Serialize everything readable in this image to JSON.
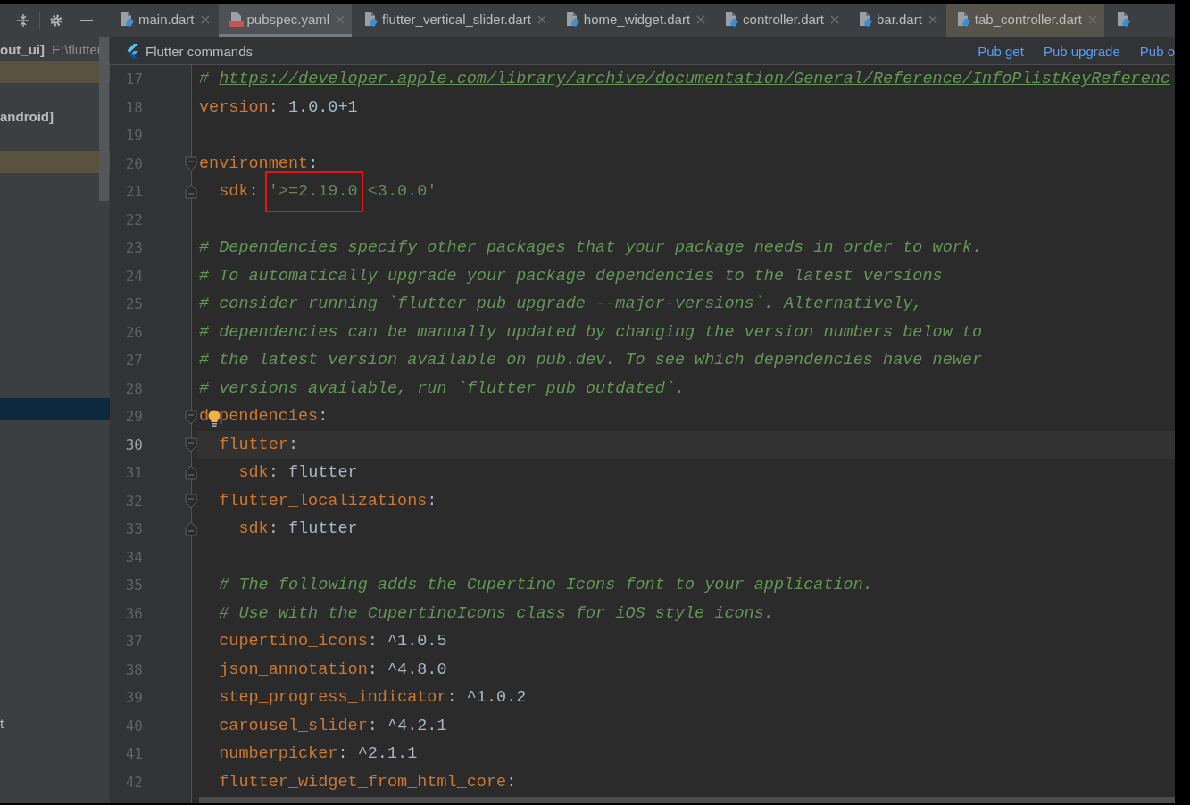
{
  "sidebar": {
    "project": "out_ui]",
    "path": "E:\\flutter",
    "items": [
      {
        "kind": "blank",
        "selected": false,
        "modified": true
      },
      {
        "kind": "blank",
        "selected": false,
        "modified": false
      },
      {
        "kind": "module",
        "label": "android]",
        "selected": false,
        "modified": false
      },
      {
        "kind": "blank",
        "selected": false,
        "modified": false
      },
      {
        "kind": "blank",
        "selected": false,
        "modified": true
      },
      {
        "kind": "blank",
        "selected": false,
        "modified": false
      },
      {
        "kind": "blank",
        "selected": false,
        "modified": false
      },
      {
        "kind": "blank",
        "selected": false,
        "modified": false
      },
      {
        "kind": "blank",
        "selected": false,
        "modified": false
      },
      {
        "kind": "blank",
        "selected": false,
        "modified": false
      },
      {
        "kind": "blank",
        "selected": false,
        "modified": false
      },
      {
        "kind": "blank",
        "selected": false,
        "modified": false
      },
      {
        "kind": "blank",
        "selected": false,
        "modified": false
      },
      {
        "kind": "blank",
        "selected": false,
        "modified": false
      },
      {
        "kind": "blank",
        "selected": false,
        "modified": false
      },
      {
        "kind": "blank",
        "selected": true,
        "modified": false
      },
      {
        "kind": "blank",
        "selected": false,
        "modified": false
      },
      {
        "kind": "blank",
        "selected": false,
        "modified": false
      },
      {
        "kind": "blank",
        "selected": false,
        "modified": false
      },
      {
        "kind": "blank",
        "selected": false,
        "modified": false
      },
      {
        "kind": "blank",
        "selected": false,
        "modified": false
      },
      {
        "kind": "blank",
        "selected": false,
        "modified": false
      },
      {
        "kind": "blank",
        "selected": false,
        "modified": false
      },
      {
        "kind": "blank",
        "selected": false,
        "modified": false
      },
      {
        "kind": "blank",
        "selected": false,
        "modified": false
      },
      {
        "kind": "blank",
        "selected": false,
        "modified": false
      },
      {
        "kind": "blank",
        "selected": false,
        "modified": false
      },
      {
        "kind": "blank",
        "selected": false,
        "modified": false
      },
      {
        "kind": "blank",
        "selected": false,
        "modified": false
      },
      {
        "kind": "file",
        "label": "t",
        "selected": false,
        "modified": false
      }
    ]
  },
  "tabs": [
    {
      "kind": "dart",
      "label": "main.dart",
      "selected": false,
      "highlighted": false
    },
    {
      "kind": "yaml",
      "label": "pubspec.yaml",
      "selected": true,
      "highlighted": false
    },
    {
      "kind": "dart",
      "label": "flutter_vertical_slider.dart",
      "selected": false,
      "highlighted": false
    },
    {
      "kind": "dart",
      "label": "home_widget.dart",
      "selected": false,
      "highlighted": false
    },
    {
      "kind": "dart",
      "label": "controller.dart",
      "selected": false,
      "highlighted": false
    },
    {
      "kind": "dart",
      "label": "bar.dart",
      "selected": false,
      "highlighted": false
    },
    {
      "kind": "dart",
      "label": "tab_controller.dart",
      "selected": false,
      "highlighted": true
    },
    {
      "kind": "dart",
      "selected": false,
      "highlighted": false
    }
  ],
  "commands_bar": {
    "title": "Flutter commands",
    "actions": [
      "Pub get",
      "Pub upgrade",
      "Pub o"
    ]
  },
  "editor": {
    "lines": [
      {
        "number": "17",
        "current": false,
        "fold_start": false,
        "fold_end": false,
        "tokens": [
          {
            "kind": "comment",
            "text": "# "
          },
          {
            "kind": "link",
            "text": "https://developer.apple.com/library/archive/documentation/General/Reference/InfoPlistKeyReferenc"
          }
        ]
      },
      {
        "number": "18",
        "current": false,
        "fold_start": false,
        "fold_end": false,
        "tokens": [
          {
            "kind": "key",
            "text": "version"
          },
          {
            "kind": "punct",
            "text": ": "
          },
          {
            "kind": "value",
            "text": "1.0.0+1"
          }
        ]
      },
      {
        "number": "19",
        "current": false,
        "fold_start": false,
        "fold_end": false
      },
      {
        "number": "20",
        "current": false,
        "fold_start": true,
        "fold_end": false,
        "tokens": [
          {
            "kind": "key",
            "text": "environment"
          },
          {
            "kind": "punct",
            "text": ":"
          }
        ]
      },
      {
        "number": "21",
        "current": false,
        "fold_start": false,
        "fold_end": true,
        "tokens": [
          {
            "kind": "key",
            "text": "  sdk"
          },
          {
            "kind": "punct",
            "text": ": "
          },
          {
            "kind": "boxed_string",
            "text": "'>=2.19.0"
          },
          {
            "kind": "string",
            "text": " <3.0.0'"
          }
        ]
      },
      {
        "number": "22",
        "current": false,
        "fold_start": false,
        "fold_end": false
      },
      {
        "number": "23",
        "current": false,
        "fold_start": false,
        "fold_end": false,
        "tokens": [
          {
            "kind": "comment",
            "text": "# Dependencies specify other packages that your package needs in order to work."
          }
        ]
      },
      {
        "number": "24",
        "current": false,
        "fold_start": false,
        "fold_end": false,
        "tokens": [
          {
            "kind": "comment",
            "text": "# To automatically upgrade your package dependencies to the latest versions"
          }
        ]
      },
      {
        "number": "25",
        "current": false,
        "fold_start": false,
        "fold_end": false,
        "tokens": [
          {
            "kind": "comment",
            "text": "# consider running `flutter pub upgrade --major-versions`. Alternatively,"
          }
        ]
      },
      {
        "number": "26",
        "current": false,
        "fold_start": false,
        "fold_end": false,
        "tokens": [
          {
            "kind": "comment",
            "text": "# dependencies can be manually updated by changing the version numbers below to"
          }
        ]
      },
      {
        "number": "27",
        "current": false,
        "fold_start": false,
        "fold_end": false,
        "tokens": [
          {
            "kind": "comment",
            "text": "# the latest version available on pub.dev. To see which dependencies have newer"
          }
        ]
      },
      {
        "number": "28",
        "current": false,
        "fold_start": false,
        "fold_end": false,
        "tokens": [
          {
            "kind": "comment",
            "text": "# versions available, run `flutter pub outdated`."
          }
        ]
      },
      {
        "number": "29",
        "current": false,
        "fold_start": true,
        "fold_end": false,
        "tokens": [
          {
            "kind": "key",
            "text": "d"
          },
          {
            "kind": "bulb"
          },
          {
            "kind": "key",
            "text": "pendencies"
          },
          {
            "kind": "punct",
            "text": ":"
          }
        ]
      },
      {
        "number": "30",
        "current": true,
        "fold_start": true,
        "fold_end": false,
        "tokens": [
          {
            "kind": "key",
            "text": "  flutter"
          },
          {
            "kind": "punct",
            "text": ":"
          }
        ]
      },
      {
        "number": "31",
        "current": false,
        "fold_start": false,
        "fold_end": true,
        "tokens": [
          {
            "kind": "key",
            "text": "    sdk"
          },
          {
            "kind": "punct",
            "text": ": "
          },
          {
            "kind": "value",
            "text": "flutter"
          }
        ]
      },
      {
        "number": "32",
        "current": false,
        "fold_start": true,
        "fold_end": false,
        "tokens": [
          {
            "kind": "key",
            "text": "  flutter_localizations"
          },
          {
            "kind": "punct",
            "text": ":"
          }
        ]
      },
      {
        "number": "33",
        "current": false,
        "fold_start": false,
        "fold_end": true,
        "tokens": [
          {
            "kind": "key",
            "text": "    sdk"
          },
          {
            "kind": "punct",
            "text": ": "
          },
          {
            "kind": "value",
            "text": "flutter"
          }
        ]
      },
      {
        "number": "34",
        "current": false,
        "fold_start": false,
        "fold_end": false
      },
      {
        "number": "35",
        "current": false,
        "fold_start": false,
        "fold_end": false,
        "tokens": [
          {
            "kind": "comment",
            "text": "  # The following adds the Cupertino Icons font to your application."
          }
        ]
      },
      {
        "number": "36",
        "current": false,
        "fold_start": false,
        "fold_end": false,
        "tokens": [
          {
            "kind": "comment",
            "text": "  # Use with the CupertinoIcons class for iOS style icons."
          }
        ]
      },
      {
        "number": "37",
        "current": false,
        "fold_start": false,
        "fold_end": false,
        "tokens": [
          {
            "kind": "key",
            "text": "  cupertino_icons"
          },
          {
            "kind": "punct",
            "text": ": "
          },
          {
            "kind": "value",
            "text": "^1.0.5"
          }
        ]
      },
      {
        "number": "38",
        "current": false,
        "fold_start": false,
        "fold_end": false,
        "tokens": [
          {
            "kind": "key",
            "text": "  json_annotation"
          },
          {
            "kind": "punct",
            "text": ": "
          },
          {
            "kind": "value",
            "text": "^4.8.0"
          }
        ]
      },
      {
        "number": "39",
        "current": false,
        "fold_start": false,
        "fold_end": false,
        "tokens": [
          {
            "kind": "key",
            "text": "  step_progress_indicator"
          },
          {
            "kind": "punct",
            "text": ": "
          },
          {
            "kind": "value",
            "text": "^1.0.2"
          }
        ]
      },
      {
        "number": "40",
        "current": false,
        "fold_start": false,
        "fold_end": false,
        "tokens": [
          {
            "kind": "key",
            "text": "  carousel_slider"
          },
          {
            "kind": "punct",
            "text": ": "
          },
          {
            "kind": "value",
            "text": "^4.2.1"
          }
        ]
      },
      {
        "number": "41",
        "current": false,
        "fold_start": false,
        "fold_end": false,
        "tokens": [
          {
            "kind": "key",
            "text": "  numberpicker"
          },
          {
            "kind": "punct",
            "text": ": "
          },
          {
            "kind": "value",
            "text": "^2.1.1"
          }
        ]
      },
      {
        "number": "42",
        "current": false,
        "fold_start": false,
        "fold_end": false,
        "tokens": [
          {
            "kind": "key",
            "text": "  flutter_widget_from_html_core"
          },
          {
            "kind": "punct",
            "text": ":"
          }
        ]
      }
    ]
  }
}
